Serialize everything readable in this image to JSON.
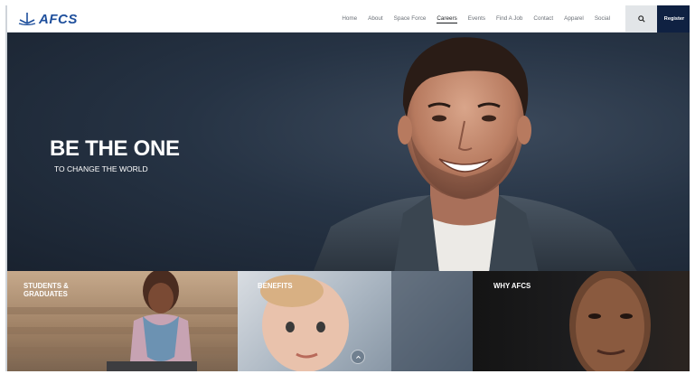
{
  "brand": {
    "name": "AFCS",
    "color": "#1e4f9c"
  },
  "nav": {
    "items": [
      {
        "label": "Home"
      },
      {
        "label": "About"
      },
      {
        "label": "Space Force"
      },
      {
        "label": "Careers",
        "active": true
      },
      {
        "label": "Events"
      },
      {
        "label": "Find A Job"
      },
      {
        "label": "Contact"
      },
      {
        "label": "Apparel"
      },
      {
        "label": "Social"
      }
    ],
    "search_icon": "search-icon",
    "register_label": "Register"
  },
  "hero": {
    "title": "BE THE ONE",
    "subtitle": "TO CHANGE THE WORLD"
  },
  "tiles": [
    {
      "label": "STUDENTS & GRADUATES"
    },
    {
      "label": "BENEFITS"
    },
    {
      "label": "WHY AFCS"
    }
  ],
  "colors": {
    "nav_active": "#1b1e22",
    "register_bg": "#0f2142",
    "search_bg": "#e2e5e8"
  }
}
